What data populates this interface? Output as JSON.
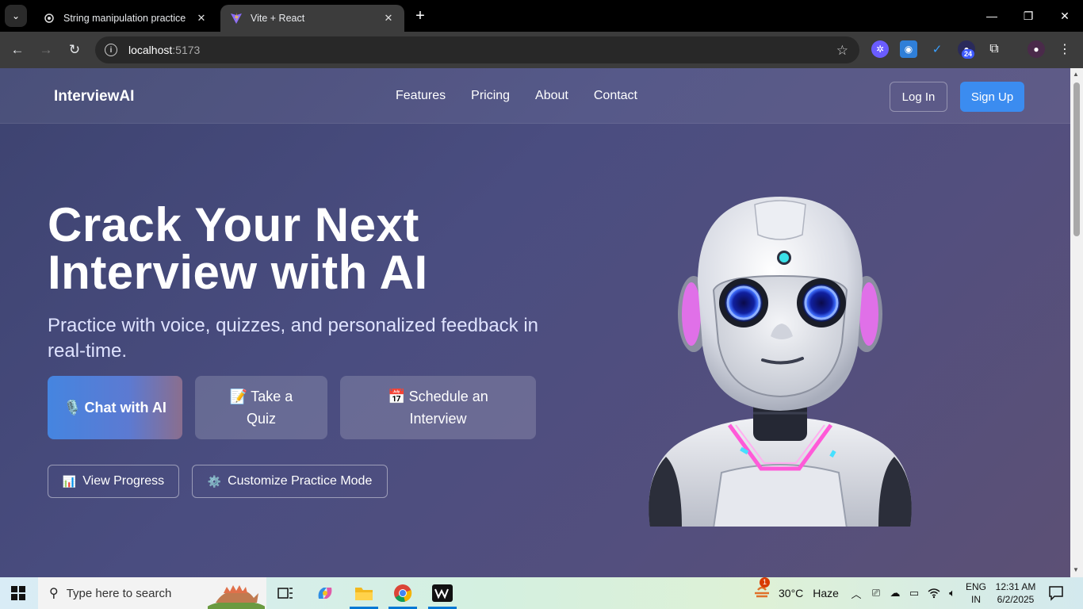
{
  "browser": {
    "tabs": [
      {
        "title": "String manipulation practice",
        "active": false
      },
      {
        "title": "Vite + React",
        "active": true
      }
    ],
    "url_host": "localhost",
    "url_port": ":5173",
    "extension_badge": "24"
  },
  "site": {
    "logo": "InterviewAI",
    "nav": [
      "Features",
      "Pricing",
      "About",
      "Contact"
    ],
    "login_label": "Log In",
    "signup_label": "Sign Up"
  },
  "hero": {
    "title_line1": "Crack Your Next",
    "title_line2": "Interview with AI",
    "subtitle": "Practice with voice, quizzes, and personalized feedback in real-time.",
    "cta": [
      {
        "icon": "🎙️",
        "label": "Chat with AI"
      },
      {
        "icon": "📝",
        "label": "Take a Quiz"
      },
      {
        "icon": "📅",
        "label": "Schedule an Interview"
      }
    ],
    "secondary": [
      {
        "icon": "📊",
        "label": "View Progress"
      },
      {
        "icon": "⚙️",
        "label": "Customize Practice Mode"
      }
    ]
  },
  "taskbar": {
    "search_placeholder": "Type here to search",
    "weather_temp": "30°C",
    "weather_desc": "Haze",
    "weather_alert": "1",
    "lang_line1": "ENG",
    "lang_line2": "IN",
    "time": "12:31 AM",
    "date": "6/2/2025"
  },
  "colors": {
    "accent_blue": "#3b8cf0",
    "hero_bg_start": "#3d4370",
    "hero_bg_end": "#5c5075"
  }
}
